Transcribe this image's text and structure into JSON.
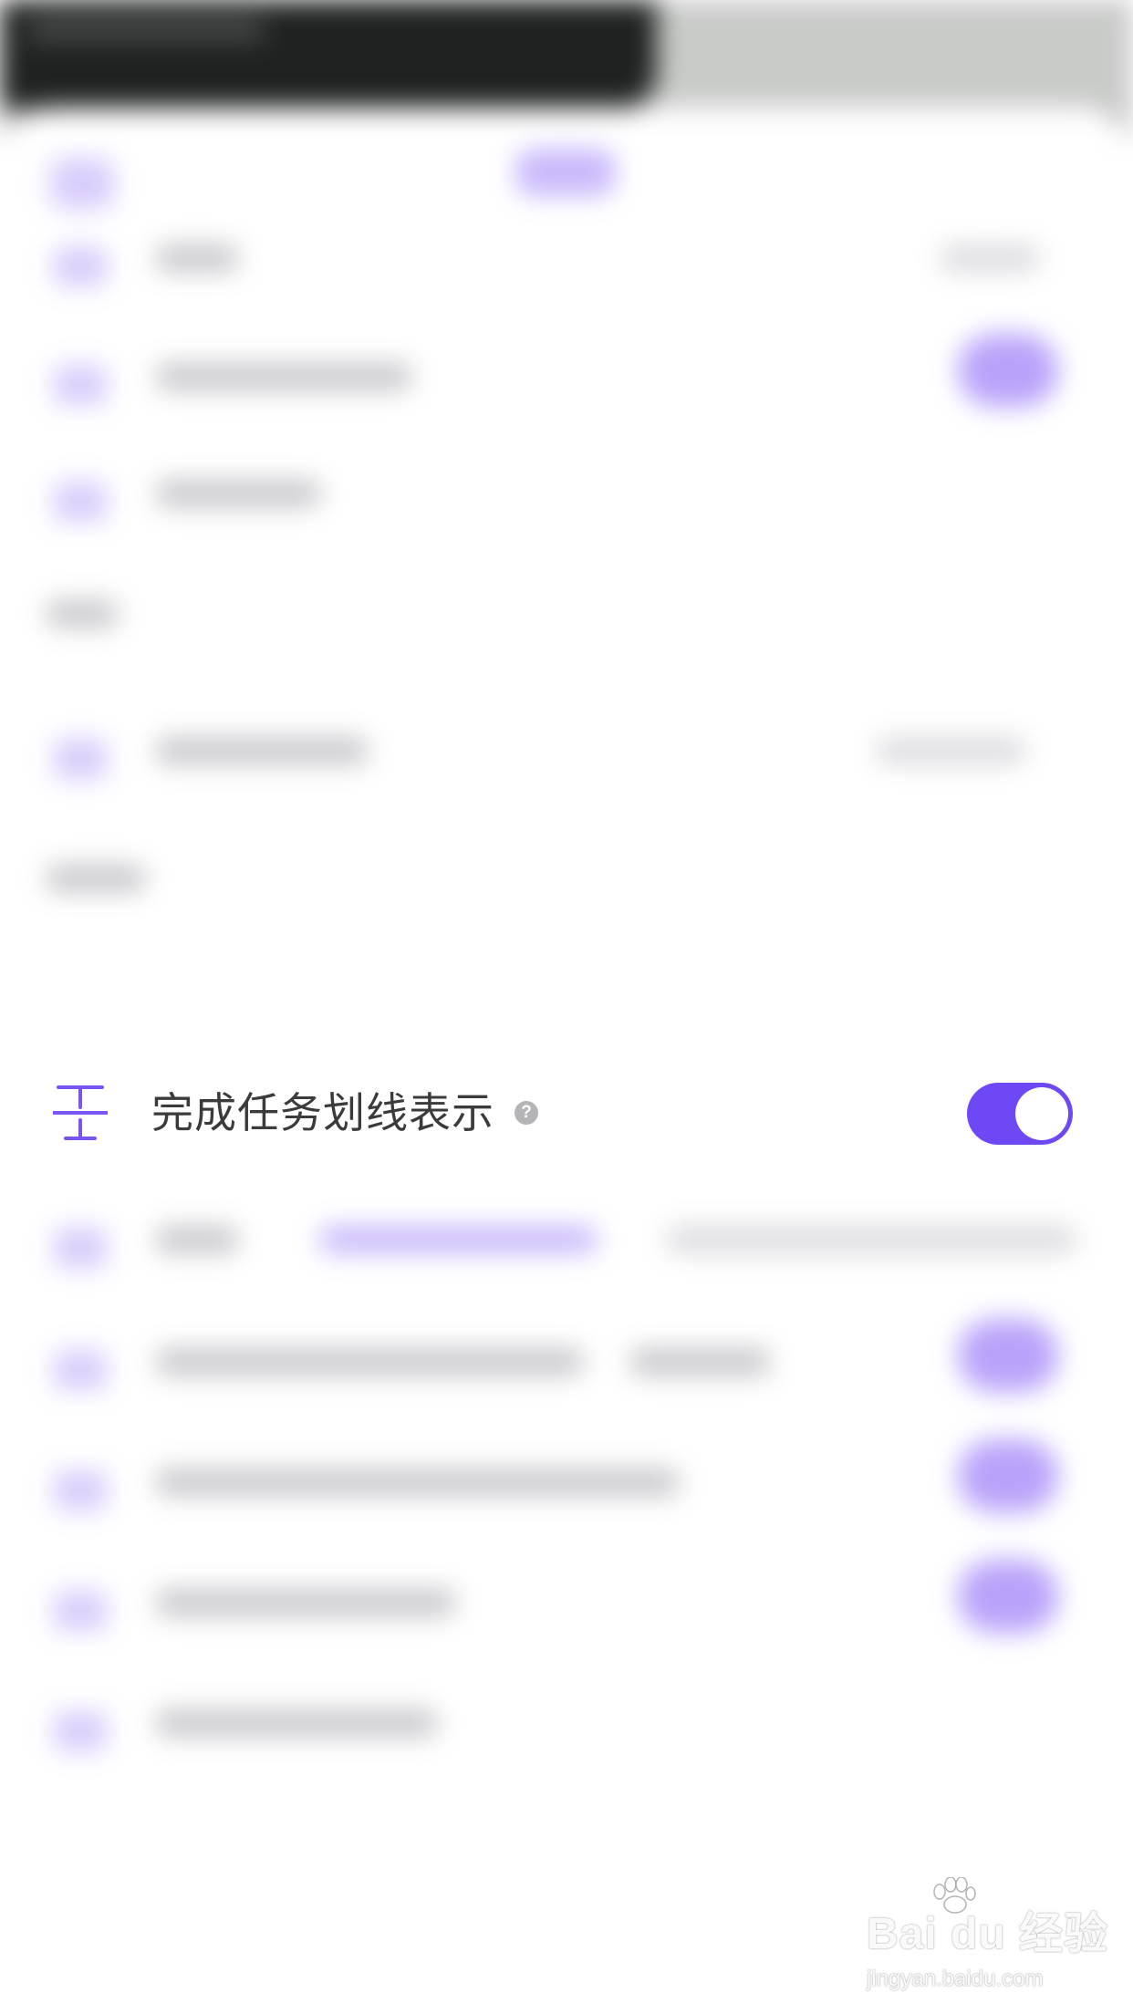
{
  "settings_row": {
    "label": "完成任务划线表示",
    "help_glyph": "?",
    "toggle_on": true
  },
  "colors": {
    "accent": "#6f48f5",
    "icon": "#7a55f2",
    "label": "#3b3b3b",
    "help_bg": "#b5b5b8"
  },
  "icons": {
    "row_icon": "strikethrough-icon",
    "help": "question-circle-icon"
  },
  "watermark": {
    "brand": "Bai du 经验",
    "url": "jingyan.baidu.com"
  }
}
